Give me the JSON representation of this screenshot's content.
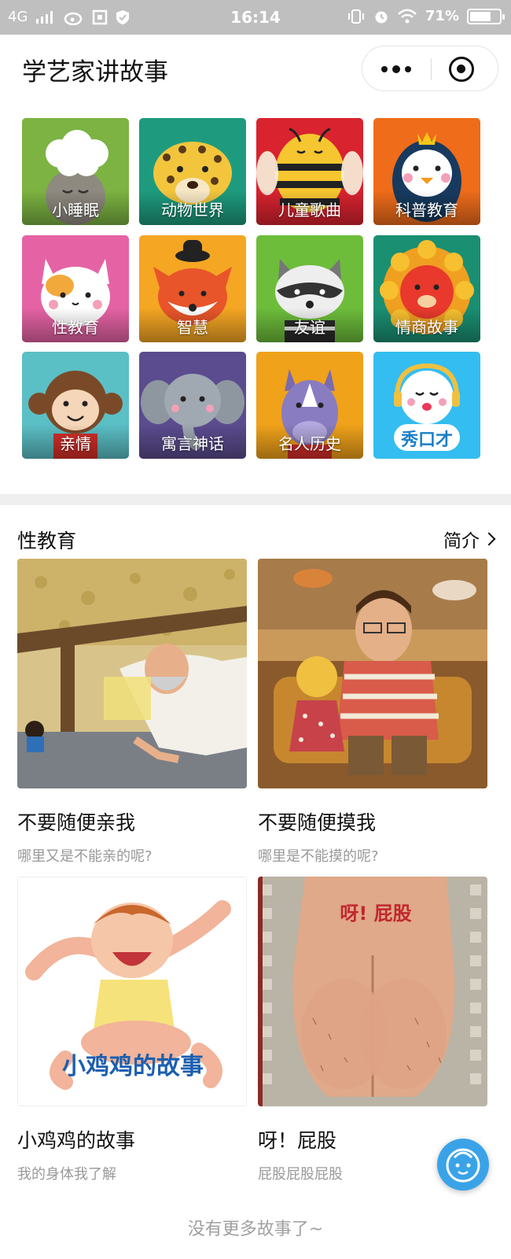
{
  "status_bar": {
    "network": "4G",
    "time": "16:14",
    "battery": "71%",
    "battery_level": 0.71
  },
  "header": {
    "title": "学艺家讲故事"
  },
  "categories": [
    {
      "label": "小睡眠",
      "bg": "#7cb342",
      "icon": "sheep-icon"
    },
    {
      "label": "动物世界",
      "bg": "#1e9b7e",
      "icon": "leopard-icon"
    },
    {
      "label": "儿童歌曲",
      "bg": "#d9232f",
      "icon": "bee-icon"
    },
    {
      "label": "科普教育",
      "bg": "#ef6c1a",
      "icon": "penguin-icon"
    },
    {
      "label": "性教育",
      "bg": "#e563a5",
      "icon": "cat-icon"
    },
    {
      "label": "智慧",
      "bg": "#f5a623",
      "icon": "fox-icon"
    },
    {
      "label": "友谊",
      "bg": "#6dbd3b",
      "icon": "raccoon-icon"
    },
    {
      "label": "情商故事",
      "bg": "#1a8f72",
      "icon": "lion-icon"
    },
    {
      "label": "亲情",
      "bg": "#5bbfc6",
      "icon": "monkey-icon"
    },
    {
      "label": "寓言神话",
      "bg": "#5b4c8f",
      "icon": "elephant-icon"
    },
    {
      "label": "名人历史",
      "bg": "#f0a21a",
      "icon": "rhino-icon"
    },
    {
      "label": "秀口才",
      "bg": "#34bdf0",
      "icon": "speaker-mascot-icon"
    }
  ],
  "section": {
    "title": "性教育",
    "intro_label": "简介"
  },
  "stories": [
    {
      "title": "不要随便亲我",
      "desc": "哪里又是不能亲的呢?"
    },
    {
      "title": "不要随便摸我",
      "desc": "哪里是不能摸的呢?"
    },
    {
      "title": "小鸡鸡的故事",
      "desc": "我的身体我了解",
      "cover_text": "小鸡鸡的故事"
    },
    {
      "title": "呀！屁股",
      "desc": "屁股屁股屁股",
      "cover_text": "呀! 屁股"
    }
  ],
  "footer": {
    "text": "没有更多故事了~"
  }
}
